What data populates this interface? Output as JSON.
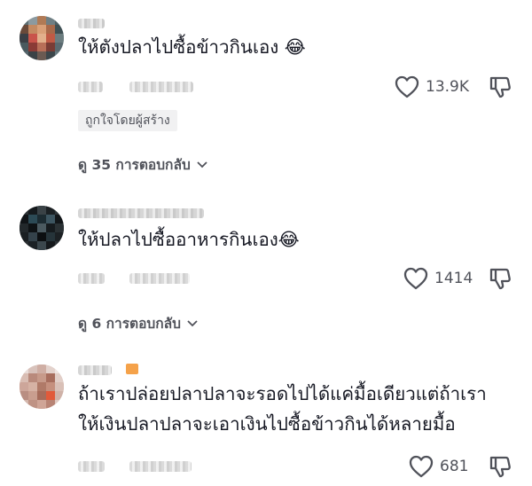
{
  "comments": [
    {
      "text_lines": [
        "ให้ตังปลาไปซื้อข้าวกินเอง 😂"
      ],
      "likes": "13.9K",
      "creator_badge": "ถูกใจโดยผู้สร้าง",
      "replies_label": "ดู 35 การตอบกลับ"
    },
    {
      "text_lines": [
        "ให้ปลาไปซื้ออาหารกินเอง😂"
      ],
      "likes": "1414",
      "replies_label": "ดู 6 การตอบกลับ"
    },
    {
      "text_lines": [
        "ถ้าเราปล่อยปลาปลาจะรอดไปได้แค่มื้อเดียวแต่ถ้าเรา",
        "ให้เงินปลาปลาจะเอาเงินไปซื้อข้าวกินได้หลายมื้อ"
      ],
      "likes": "681"
    }
  ],
  "icons": {
    "like": "heart-outline-icon",
    "dislike": "thumbs-down-outline-icon",
    "expand": "chevron-down-icon"
  },
  "colors": {
    "text": "#161823",
    "secondary": "#50525a",
    "badge_bg": "#f1f1f2"
  }
}
